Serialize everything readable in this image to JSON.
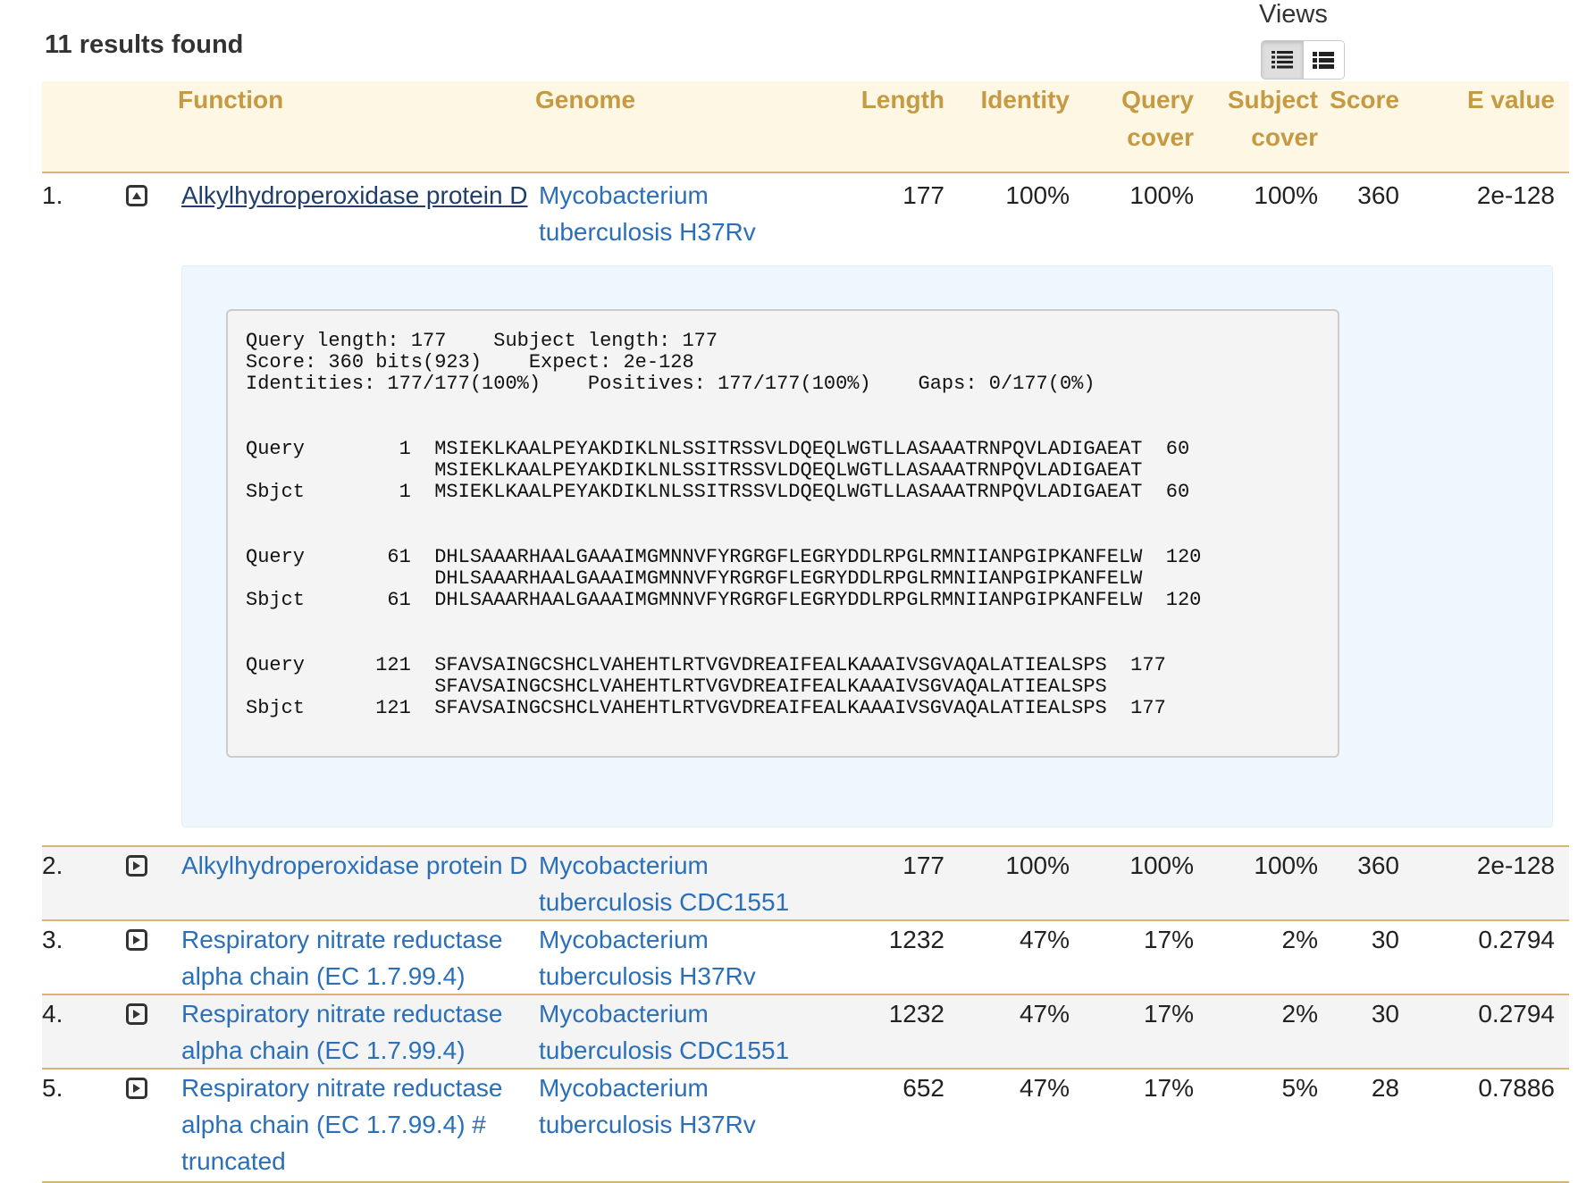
{
  "header": {
    "results_text": "11 results found",
    "views_label": "Views",
    "views": [
      {
        "name": "detailed-list",
        "active": true
      },
      {
        "name": "compact-list",
        "active": false
      }
    ]
  },
  "columns": {
    "function": "Function",
    "genome": "Genome",
    "length": "Length",
    "identity": "Identity",
    "query_cover_1": "Query",
    "query_cover_2": "cover",
    "subject_cover_1": "Subject",
    "subject_cover_2": "cover",
    "score": "Score",
    "evalue": "E value"
  },
  "rows": [
    {
      "num": "1.",
      "fn": [
        "Alkylhydroperoxidase protein D"
      ],
      "genome": [
        "Mycobacterium",
        "tuberculosis H37Rv"
      ],
      "length": "177",
      "identity": "100%",
      "qcover": "100%",
      "scover": "100%",
      "score": "360",
      "evalue": "2e-128",
      "expanded": true
    },
    {
      "num": "2.",
      "fn": [
        "Alkylhydroperoxidase protein D"
      ],
      "genome": [
        "Mycobacterium",
        "tuberculosis CDC1551"
      ],
      "length": "177",
      "identity": "100%",
      "qcover": "100%",
      "scover": "100%",
      "score": "360",
      "evalue": "2e-128",
      "expanded": false
    },
    {
      "num": "3.",
      "fn": [
        "Respiratory nitrate reductase",
        "alpha chain (EC 1.7.99.4)"
      ],
      "genome": [
        "Mycobacterium",
        "tuberculosis H37Rv"
      ],
      "length": "1232",
      "identity": "47%",
      "qcover": "17%",
      "scover": "2%",
      "score": "30",
      "evalue": "0.2794",
      "expanded": false
    },
    {
      "num": "4.",
      "fn": [
        "Respiratory nitrate reductase",
        "alpha chain (EC 1.7.99.4)"
      ],
      "genome": [
        "Mycobacterium",
        "tuberculosis CDC1551"
      ],
      "length": "1232",
      "identity": "47%",
      "qcover": "17%",
      "scover": "2%",
      "score": "30",
      "evalue": "0.2794",
      "expanded": false
    },
    {
      "num": "5.",
      "fn": [
        "Respiratory nitrate reductase",
        "alpha chain (EC 1.7.99.4) #",
        "truncated"
      ],
      "genome": [
        "Mycobacterium",
        "tuberculosis H37Rv"
      ],
      "length": "652",
      "identity": "47%",
      "qcover": "17%",
      "scover": "5%",
      "score": "28",
      "evalue": "0.7886",
      "expanded": false
    }
  ],
  "alignment": {
    "summary": [
      "Query length: 177    Subject length: 177",
      "Score: 360 bits(923)    Expect: 2e-128",
      "Identities: 177/177(100%)    Positives: 177/177(100%)    Gaps: 0/177(0%)"
    ],
    "blocks": [
      [
        "Query        1  MSIEKLKAALPEYAKDIKLNLSSITRSSVLDQEQLWGTLLASAAATRNPQVLADIGAEAT  60",
        "                MSIEKLKAALPEYAKDIKLNLSSITRSSVLDQEQLWGTLLASAAATRNPQVLADIGAEAT",
        "Sbjct        1  MSIEKLKAALPEYAKDIKLNLSSITRSSVLDQEQLWGTLLASAAATRNPQVLADIGAEAT  60"
      ],
      [
        "Query       61  DHLSAAARHAALGAAAIMGMNNVFYRGRGFLEGRYDDLRPGLRMNIIANPGIPKANFELW  120",
        "                DHLSAAARHAALGAAAIMGMNNVFYRGRGFLEGRYDDLRPGLRMNIIANPGIPKANFELW",
        "Sbjct       61  DHLSAAARHAALGAAAIMGMNNVFYRGRGFLEGRYDDLRPGLRMNIIANPGIPKANFELW  120"
      ],
      [
        "Query      121  SFAVSAINGCSHCLVAHEHTLRTVGVDREAIFEALKAAAIVSGVAQALATIEALSPS  177",
        "                SFAVSAINGCSHCLVAHEHTLRTVGVDREAIFEALKAAAIVSGVAQALATIEALSPS",
        "Sbjct      121  SFAVSAINGCSHCLVAHEHTLRTVGVDREAIFEALKAAAIVSGVAQALATIEALSPS  177"
      ]
    ]
  }
}
